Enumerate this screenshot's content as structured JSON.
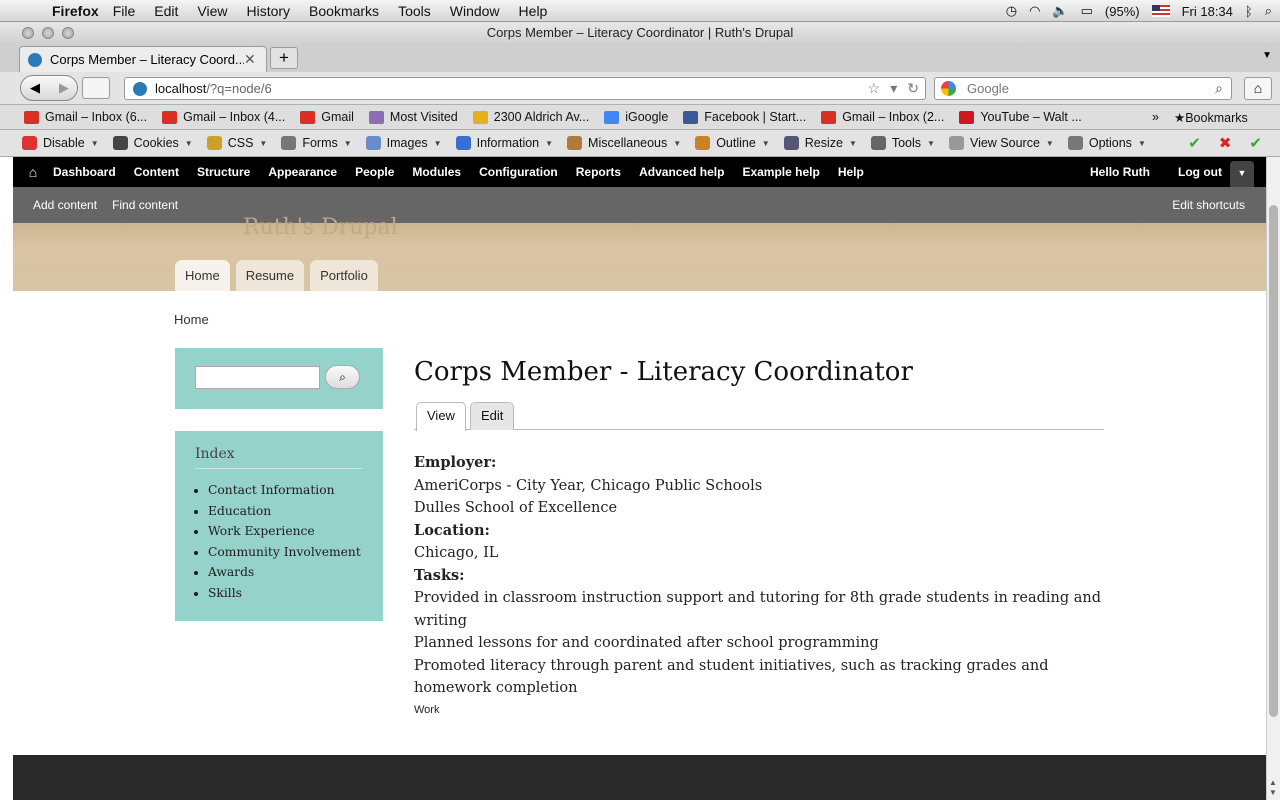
{
  "menubar": {
    "app": "Firefox",
    "items": [
      "File",
      "Edit",
      "View",
      "History",
      "Bookmarks",
      "Tools",
      "Window",
      "Help"
    ],
    "battery": "(95%)",
    "clock": "Fri 18:34"
  },
  "window": {
    "title": "Corps Member – Literacy Coordinator | Ruth's Drupal"
  },
  "tab": {
    "label": "Corps Member – Literacy Coord...",
    "new_tab": "+"
  },
  "navbar": {
    "url_host": "localhost",
    "url_path": "/?q=node/6",
    "search_placeholder": "Google"
  },
  "bookmarks": {
    "items": [
      {
        "label": "Gmail – Inbox (6...",
        "color": "#d93025"
      },
      {
        "label": "Gmail – Inbox (4...",
        "color": "#d93025"
      },
      {
        "label": "Gmail",
        "color": "#d93025"
      },
      {
        "label": "Most Visited",
        "color": "#8a6fb3"
      },
      {
        "label": "2300 Aldrich Av...",
        "color": "#e3b21b"
      },
      {
        "label": "iGoogle",
        "color": "#4285f4"
      },
      {
        "label": "Facebook | Start...",
        "color": "#3b5998"
      },
      {
        "label": "Gmail – Inbox (2...",
        "color": "#d93025"
      },
      {
        "label": "YouTube – Walt ...",
        "color": "#cc181e"
      }
    ],
    "more": "»",
    "bookmarks_menu": "Bookmarks"
  },
  "webdev": {
    "items": [
      {
        "label": "Disable",
        "color": "#d33"
      },
      {
        "label": "Cookies",
        "color": "#444"
      },
      {
        "label": "CSS",
        "color": "#c9a227"
      },
      {
        "label": "Forms",
        "color": "#777"
      },
      {
        "label": "Images",
        "color": "#6a8cc7"
      },
      {
        "label": "Information",
        "color": "#3a6fcf"
      },
      {
        "label": "Miscellaneous",
        "color": "#b07a3a"
      },
      {
        "label": "Outline",
        "color": "#c9822a"
      },
      {
        "label": "Resize",
        "color": "#557"
      },
      {
        "label": "Tools",
        "color": "#666"
      },
      {
        "label": "View Source",
        "color": "#999"
      },
      {
        "label": "Options",
        "color": "#777"
      }
    ]
  },
  "toolbar": {
    "items": [
      "Dashboard",
      "Content",
      "Structure",
      "Appearance",
      "People",
      "Modules",
      "Configuration",
      "Reports",
      "Advanced help",
      "Example help",
      "Help"
    ],
    "user": "Hello Ruth",
    "logout": "Log out"
  },
  "shortcuts": {
    "items": [
      "Add content",
      "Find content"
    ],
    "edit": "Edit shortcuts"
  },
  "site": {
    "name": "Ruth's Drupal",
    "primary_tabs": [
      "Home",
      "Resume",
      "Portfolio"
    ]
  },
  "breadcrumb": "Home",
  "sidebar": {
    "index_title": "Index",
    "index_items": [
      "Contact Information",
      "Education",
      "Work Experience",
      "Community Involvement",
      "Awards",
      "Skills"
    ]
  },
  "node": {
    "title": "Corps Member - Literacy Coordinator",
    "tabs": [
      "View",
      "Edit"
    ],
    "employer_label": "Employer:",
    "employer_lines": [
      "AmeriCorps - City Year, Chicago Public Schools",
      "Dulles School of Excellence"
    ],
    "location_label": "Location:",
    "location": "Chicago, IL",
    "tasks_label": "Tasks:",
    "tasks": [
      "Provided in classroom instruction support and tutoring for 8th grade students in reading and writing",
      "Planned lessons for and coordinated after school programming",
      "Promoted literacy through parent and student initiatives, such as tracking grades and homework completion"
    ],
    "term": "Work"
  },
  "colors": {
    "header": "#d8c5a4",
    "sidebar_block": "#95d2c9",
    "footer": "#292929"
  }
}
